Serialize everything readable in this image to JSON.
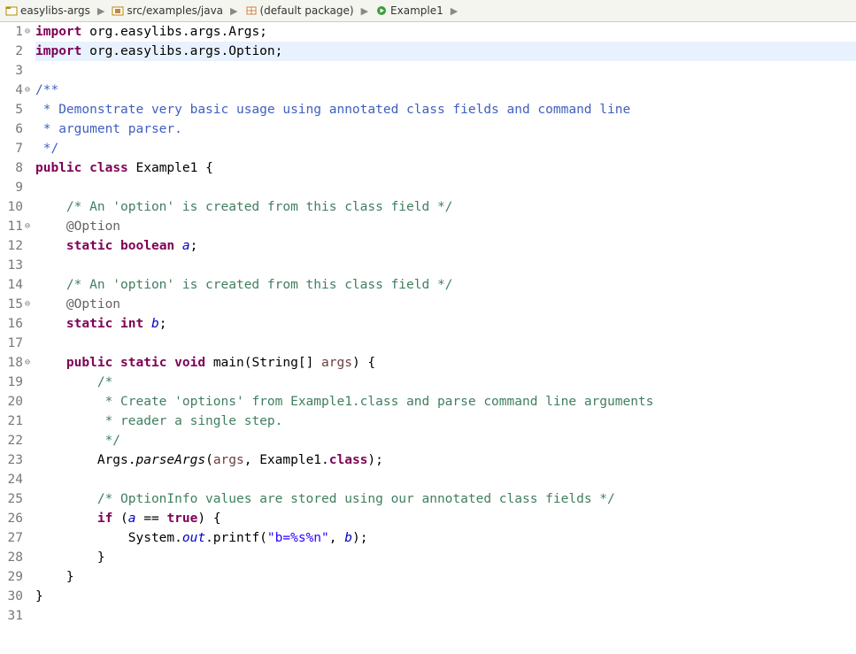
{
  "breadcrumb": {
    "items": [
      {
        "icon": "project",
        "label": "easylibs-args"
      },
      {
        "icon": "src-folder",
        "label": "src/examples/java"
      },
      {
        "icon": "package",
        "label": "(default package)"
      },
      {
        "icon": "class-run",
        "label": "Example1"
      },
      {
        "icon": "",
        "label": ""
      }
    ]
  },
  "code": {
    "lines": [
      {
        "n": 1,
        "fold": "⊖",
        "kind": "import",
        "tokens": [
          {
            "cls": "kw",
            "t": "import"
          },
          {
            "cls": "base",
            "t": " org.easylibs.args.Args;"
          }
        ]
      },
      {
        "n": 2,
        "fold": " ",
        "hl": true,
        "kind": "import",
        "tokens": [
          {
            "cls": "kw",
            "t": "import"
          },
          {
            "cls": "base",
            "t": " org.easylibs.args.Option;"
          }
        ]
      },
      {
        "n": 3,
        "fold": " ",
        "tokens": []
      },
      {
        "n": 4,
        "fold": "⊖",
        "tokens": [
          {
            "cls": "jd",
            "t": "/**"
          }
        ]
      },
      {
        "n": 5,
        "fold": " ",
        "tokens": [
          {
            "cls": "jd",
            "t": " * Demonstrate very basic usage using annotated class fields and command line"
          }
        ]
      },
      {
        "n": 6,
        "fold": " ",
        "tokens": [
          {
            "cls": "jd",
            "t": " * argument parser."
          }
        ]
      },
      {
        "n": 7,
        "fold": " ",
        "tokens": [
          {
            "cls": "jd",
            "t": " */"
          }
        ]
      },
      {
        "n": 8,
        "fold": " ",
        "tokens": [
          {
            "cls": "kw",
            "t": "public"
          },
          {
            "cls": "base",
            "t": " "
          },
          {
            "cls": "kw",
            "t": "class"
          },
          {
            "cls": "base",
            "t": " Example1 {"
          }
        ]
      },
      {
        "n": 9,
        "fold": " ",
        "tokens": []
      },
      {
        "n": 10,
        "fold": " ",
        "tokens": [
          {
            "cls": "base",
            "t": "    "
          },
          {
            "cls": "cm",
            "t": "/* An 'option' is created from this class field */"
          }
        ]
      },
      {
        "n": 11,
        "fold": "⊖",
        "tokens": [
          {
            "cls": "base",
            "t": "    "
          },
          {
            "cls": "an",
            "t": "@Option"
          }
        ]
      },
      {
        "n": 12,
        "fold": " ",
        "tokens": [
          {
            "cls": "base",
            "t": "    "
          },
          {
            "cls": "kw",
            "t": "static"
          },
          {
            "cls": "base",
            "t": " "
          },
          {
            "cls": "kw",
            "t": "boolean"
          },
          {
            "cls": "base",
            "t": " "
          },
          {
            "cls": "sf",
            "t": "a"
          },
          {
            "cls": "base",
            "t": ";"
          }
        ]
      },
      {
        "n": 13,
        "fold": " ",
        "tokens": []
      },
      {
        "n": 14,
        "fold": " ",
        "tokens": [
          {
            "cls": "base",
            "t": "    "
          },
          {
            "cls": "cm",
            "t": "/* An 'option' is created from this class field */"
          }
        ]
      },
      {
        "n": 15,
        "fold": "⊖",
        "tokens": [
          {
            "cls": "base",
            "t": "    "
          },
          {
            "cls": "an",
            "t": "@Option"
          }
        ]
      },
      {
        "n": 16,
        "fold": " ",
        "tokens": [
          {
            "cls": "base",
            "t": "    "
          },
          {
            "cls": "kw",
            "t": "static"
          },
          {
            "cls": "base",
            "t": " "
          },
          {
            "cls": "kw",
            "t": "int"
          },
          {
            "cls": "base",
            "t": " "
          },
          {
            "cls": "sf",
            "t": "b"
          },
          {
            "cls": "base",
            "t": ";"
          }
        ]
      },
      {
        "n": 17,
        "fold": " ",
        "tokens": []
      },
      {
        "n": 18,
        "fold": "⊖",
        "tokens": [
          {
            "cls": "base",
            "t": "    "
          },
          {
            "cls": "kw",
            "t": "public"
          },
          {
            "cls": "base",
            "t": " "
          },
          {
            "cls": "kw",
            "t": "static"
          },
          {
            "cls": "base",
            "t": " "
          },
          {
            "cls": "kw",
            "t": "void"
          },
          {
            "cls": "base",
            "t": " main(String[] "
          },
          {
            "cls": "par",
            "t": "args"
          },
          {
            "cls": "base",
            "t": ") {"
          }
        ]
      },
      {
        "n": 19,
        "fold": " ",
        "tokens": [
          {
            "cls": "base",
            "t": "        "
          },
          {
            "cls": "cm",
            "t": "/*"
          }
        ]
      },
      {
        "n": 20,
        "fold": " ",
        "tokens": [
          {
            "cls": "base",
            "t": "        "
          },
          {
            "cls": "cm",
            "t": " * Create 'options' from Example1.class and parse command line arguments"
          }
        ]
      },
      {
        "n": 21,
        "fold": " ",
        "tokens": [
          {
            "cls": "base",
            "t": "        "
          },
          {
            "cls": "cm",
            "t": " * reader a single step."
          }
        ]
      },
      {
        "n": 22,
        "fold": " ",
        "tokens": [
          {
            "cls": "base",
            "t": "        "
          },
          {
            "cls": "cm",
            "t": " */"
          }
        ]
      },
      {
        "n": 23,
        "fold": " ",
        "tokens": [
          {
            "cls": "base",
            "t": "        Args."
          },
          {
            "cls": "sm",
            "t": "parseArgs"
          },
          {
            "cls": "base",
            "t": "("
          },
          {
            "cls": "par",
            "t": "args"
          },
          {
            "cls": "base",
            "t": ", Example1."
          },
          {
            "cls": "kw",
            "t": "class"
          },
          {
            "cls": "base",
            "t": ");"
          }
        ]
      },
      {
        "n": 24,
        "fold": " ",
        "tokens": []
      },
      {
        "n": 25,
        "fold": " ",
        "tokens": [
          {
            "cls": "base",
            "t": "        "
          },
          {
            "cls": "cm",
            "t": "/* OptionInfo values are stored using our annotated class fields */"
          }
        ]
      },
      {
        "n": 26,
        "fold": " ",
        "tokens": [
          {
            "cls": "base",
            "t": "        "
          },
          {
            "cls": "kw",
            "t": "if"
          },
          {
            "cls": "base",
            "t": " ("
          },
          {
            "cls": "sf",
            "t": "a"
          },
          {
            "cls": "base",
            "t": " == "
          },
          {
            "cls": "kw",
            "t": "true"
          },
          {
            "cls": "base",
            "t": ") {"
          }
        ]
      },
      {
        "n": 27,
        "fold": " ",
        "tokens": [
          {
            "cls": "base",
            "t": "            System."
          },
          {
            "cls": "sf",
            "t": "out"
          },
          {
            "cls": "base",
            "t": ".printf("
          },
          {
            "cls": "str",
            "t": "\"b=%s%n\""
          },
          {
            "cls": "base",
            "t": ", "
          },
          {
            "cls": "sf",
            "t": "b"
          },
          {
            "cls": "base",
            "t": ");"
          }
        ]
      },
      {
        "n": 28,
        "fold": " ",
        "tokens": [
          {
            "cls": "base",
            "t": "        }"
          }
        ]
      },
      {
        "n": 29,
        "fold": " ",
        "tokens": [
          {
            "cls": "base",
            "t": "    }"
          }
        ]
      },
      {
        "n": 30,
        "fold": " ",
        "tokens": [
          {
            "cls": "base",
            "t": "}"
          }
        ]
      },
      {
        "n": 31,
        "fold": " ",
        "tokens": []
      }
    ]
  }
}
